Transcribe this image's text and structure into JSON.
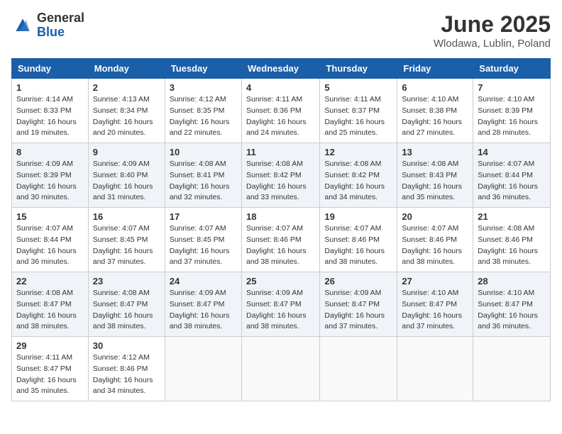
{
  "header": {
    "logo": {
      "general": "General",
      "blue": "Blue"
    },
    "title": "June 2025",
    "location": "Wlodawa, Lublin, Poland"
  },
  "calendar": {
    "headers": [
      "Sunday",
      "Monday",
      "Tuesday",
      "Wednesday",
      "Thursday",
      "Friday",
      "Saturday"
    ],
    "weeks": [
      [
        {
          "day": "1",
          "sunrise": "4:14 AM",
          "sunset": "8:33 PM",
          "daylight": "16 hours and 19 minutes."
        },
        {
          "day": "2",
          "sunrise": "4:13 AM",
          "sunset": "8:34 PM",
          "daylight": "16 hours and 20 minutes."
        },
        {
          "day": "3",
          "sunrise": "4:12 AM",
          "sunset": "8:35 PM",
          "daylight": "16 hours and 22 minutes."
        },
        {
          "day": "4",
          "sunrise": "4:11 AM",
          "sunset": "8:36 PM",
          "daylight": "16 hours and 24 minutes."
        },
        {
          "day": "5",
          "sunrise": "4:11 AM",
          "sunset": "8:37 PM",
          "daylight": "16 hours and 25 minutes."
        },
        {
          "day": "6",
          "sunrise": "4:10 AM",
          "sunset": "8:38 PM",
          "daylight": "16 hours and 27 minutes."
        },
        {
          "day": "7",
          "sunrise": "4:10 AM",
          "sunset": "8:39 PM",
          "daylight": "16 hours and 28 minutes."
        }
      ],
      [
        {
          "day": "8",
          "sunrise": "4:09 AM",
          "sunset": "8:39 PM",
          "daylight": "16 hours and 30 minutes."
        },
        {
          "day": "9",
          "sunrise": "4:09 AM",
          "sunset": "8:40 PM",
          "daylight": "16 hours and 31 minutes."
        },
        {
          "day": "10",
          "sunrise": "4:08 AM",
          "sunset": "8:41 PM",
          "daylight": "16 hours and 32 minutes."
        },
        {
          "day": "11",
          "sunrise": "4:08 AM",
          "sunset": "8:42 PM",
          "daylight": "16 hours and 33 minutes."
        },
        {
          "day": "12",
          "sunrise": "4:08 AM",
          "sunset": "8:42 PM",
          "daylight": "16 hours and 34 minutes."
        },
        {
          "day": "13",
          "sunrise": "4:08 AM",
          "sunset": "8:43 PM",
          "daylight": "16 hours and 35 minutes."
        },
        {
          "day": "14",
          "sunrise": "4:07 AM",
          "sunset": "8:44 PM",
          "daylight": "16 hours and 36 minutes."
        }
      ],
      [
        {
          "day": "15",
          "sunrise": "4:07 AM",
          "sunset": "8:44 PM",
          "daylight": "16 hours and 36 minutes."
        },
        {
          "day": "16",
          "sunrise": "4:07 AM",
          "sunset": "8:45 PM",
          "daylight": "16 hours and 37 minutes."
        },
        {
          "day": "17",
          "sunrise": "4:07 AM",
          "sunset": "8:45 PM",
          "daylight": "16 hours and 37 minutes."
        },
        {
          "day": "18",
          "sunrise": "4:07 AM",
          "sunset": "8:46 PM",
          "daylight": "16 hours and 38 minutes."
        },
        {
          "day": "19",
          "sunrise": "4:07 AM",
          "sunset": "8:46 PM",
          "daylight": "16 hours and 38 minutes."
        },
        {
          "day": "20",
          "sunrise": "4:07 AM",
          "sunset": "8:46 PM",
          "daylight": "16 hours and 38 minutes."
        },
        {
          "day": "21",
          "sunrise": "4:08 AM",
          "sunset": "8:46 PM",
          "daylight": "16 hours and 38 minutes."
        }
      ],
      [
        {
          "day": "22",
          "sunrise": "4:08 AM",
          "sunset": "8:47 PM",
          "daylight": "16 hours and 38 minutes."
        },
        {
          "day": "23",
          "sunrise": "4:08 AM",
          "sunset": "8:47 PM",
          "daylight": "16 hours and 38 minutes."
        },
        {
          "day": "24",
          "sunrise": "4:09 AM",
          "sunset": "8:47 PM",
          "daylight": "16 hours and 38 minutes."
        },
        {
          "day": "25",
          "sunrise": "4:09 AM",
          "sunset": "8:47 PM",
          "daylight": "16 hours and 38 minutes."
        },
        {
          "day": "26",
          "sunrise": "4:09 AM",
          "sunset": "8:47 PM",
          "daylight": "16 hours and 37 minutes."
        },
        {
          "day": "27",
          "sunrise": "4:10 AM",
          "sunset": "8:47 PM",
          "daylight": "16 hours and 37 minutes."
        },
        {
          "day": "28",
          "sunrise": "4:10 AM",
          "sunset": "8:47 PM",
          "daylight": "16 hours and 36 minutes."
        }
      ],
      [
        {
          "day": "29",
          "sunrise": "4:11 AM",
          "sunset": "8:47 PM",
          "daylight": "16 hours and 35 minutes."
        },
        {
          "day": "30",
          "sunrise": "4:12 AM",
          "sunset": "8:46 PM",
          "daylight": "16 hours and 34 minutes."
        },
        null,
        null,
        null,
        null,
        null
      ]
    ]
  }
}
